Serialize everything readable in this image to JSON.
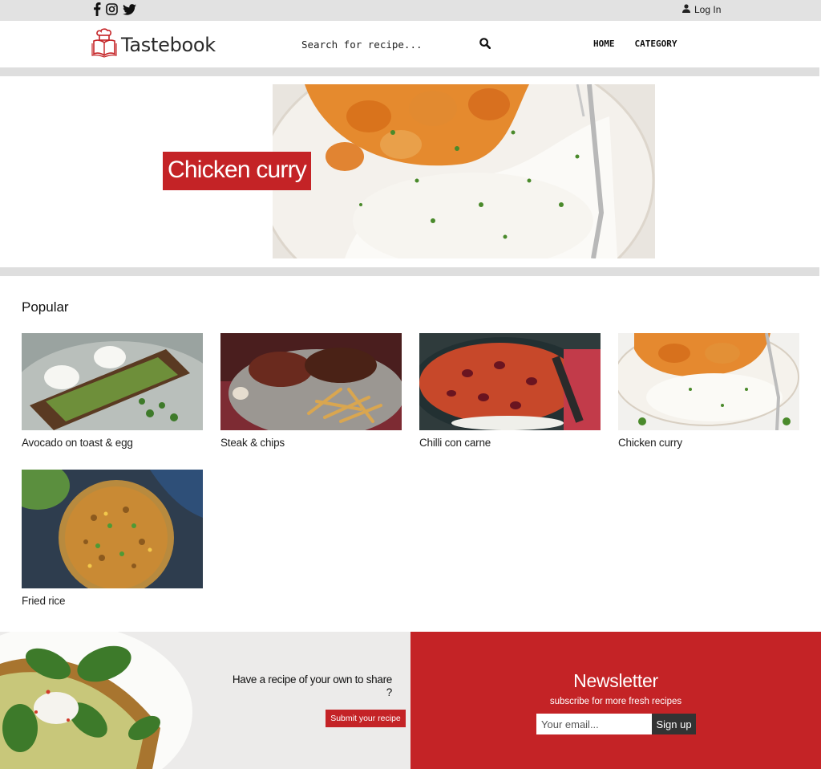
{
  "topbar": {
    "social_icons": [
      "facebook-icon",
      "instagram-icon",
      "twitter-icon"
    ],
    "login_label": "Log In",
    "login_icon": "user-icon"
  },
  "header": {
    "logo_text": "Tastebook",
    "search_placeholder": "Search for recipe...",
    "search_icon": "search-icon",
    "nav": [
      {
        "label": "HOME"
      },
      {
        "label": "CATEGORY"
      }
    ]
  },
  "hero": {
    "title": "Chicken curry"
  },
  "popular": {
    "title": "Popular",
    "items": [
      {
        "name": "Avocado on toast & egg"
      },
      {
        "name": "Steak & chips"
      },
      {
        "name": "Chilli con carne"
      },
      {
        "name": "Chicken curry"
      },
      {
        "name": "Fried rice"
      }
    ]
  },
  "footer": {
    "share_text": "Have a recipe of your own to share ?",
    "submit_label": "Submit your recipe",
    "newsletter": {
      "title": "Newsletter",
      "subtitle": "subscribe for more fresh recipes",
      "email_placeholder": "Your email...",
      "button_label": "Sign up"
    }
  },
  "colors": {
    "brand_red": "#c42326",
    "band_gray": "#dedede",
    "dark_button": "#333333"
  }
}
